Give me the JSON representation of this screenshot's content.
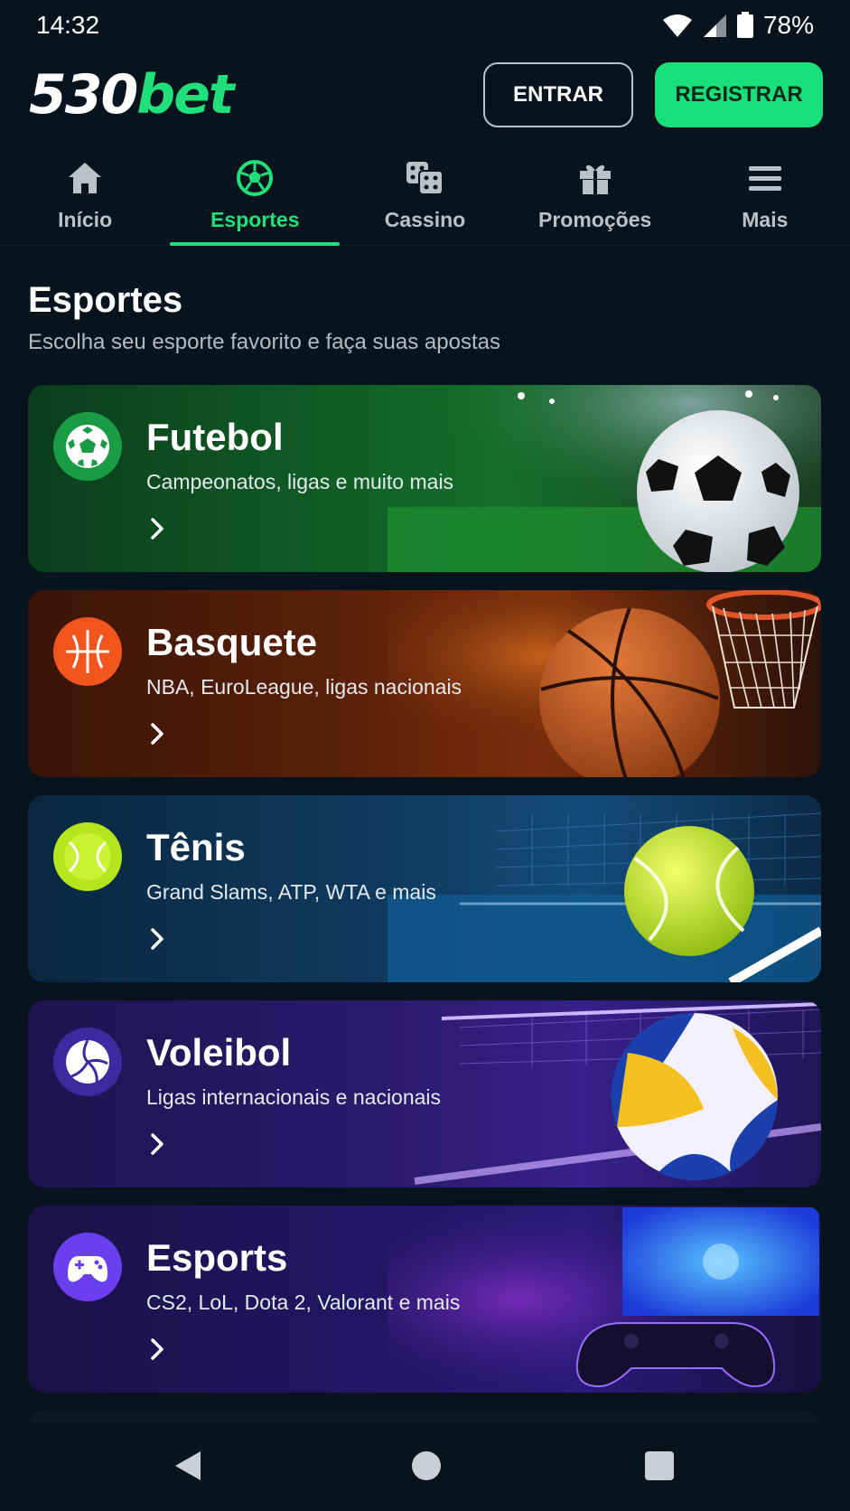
{
  "status_bar": {
    "time": "14:32",
    "battery": "78%",
    "icons": [
      "wifi-icon",
      "signal-icon",
      "battery-icon"
    ]
  },
  "header": {
    "logo_number": "530",
    "logo_brand": "bet",
    "login_label": "ENTRAR",
    "register_label": "REGISTRAR"
  },
  "nav": {
    "items": [
      {
        "label": "Início",
        "icon": "home-icon"
      },
      {
        "label": "Esportes",
        "icon": "soccer-ball-icon",
        "active": true
      },
      {
        "label": "Cassino",
        "icon": "dice-icon"
      },
      {
        "label": "Promoções",
        "icon": "gift-icon"
      },
      {
        "label": "Mais",
        "icon": "menu-icon"
      }
    ]
  },
  "section": {
    "title": "Esportes",
    "subtitle": "Escolha seu esporte favorito e faça suas apostas"
  },
  "sports": [
    {
      "title": "Futebol",
      "description": "Campeonatos, ligas e muito mais",
      "icon": "soccer-ball-icon",
      "accent": "#1a9c45"
    },
    {
      "title": "Basquete",
      "description": "NBA, EuroLeague, ligas nacionais",
      "icon": "basketball-icon",
      "accent": "#f2561d"
    },
    {
      "title": "Tênis",
      "description": "Grand Slams, ATP, WTA e mais",
      "icon": "tennis-ball-icon",
      "accent": "#b5e61d"
    },
    {
      "title": "Voleibol",
      "description": "Ligas internacionais e nacionais",
      "icon": "volleyball-icon",
      "accent": "#3b2aa0"
    },
    {
      "title": "Esports",
      "description": "CS2, LoL, Dota 2, Valorant e mais",
      "icon": "gamepad-icon",
      "accent": "#6a3ff0"
    }
  ],
  "colors": {
    "background": "#07131d",
    "brand_green": "#1fe07a"
  },
  "system_nav": [
    "back-icon",
    "home-circle-icon",
    "recents-icon"
  ]
}
